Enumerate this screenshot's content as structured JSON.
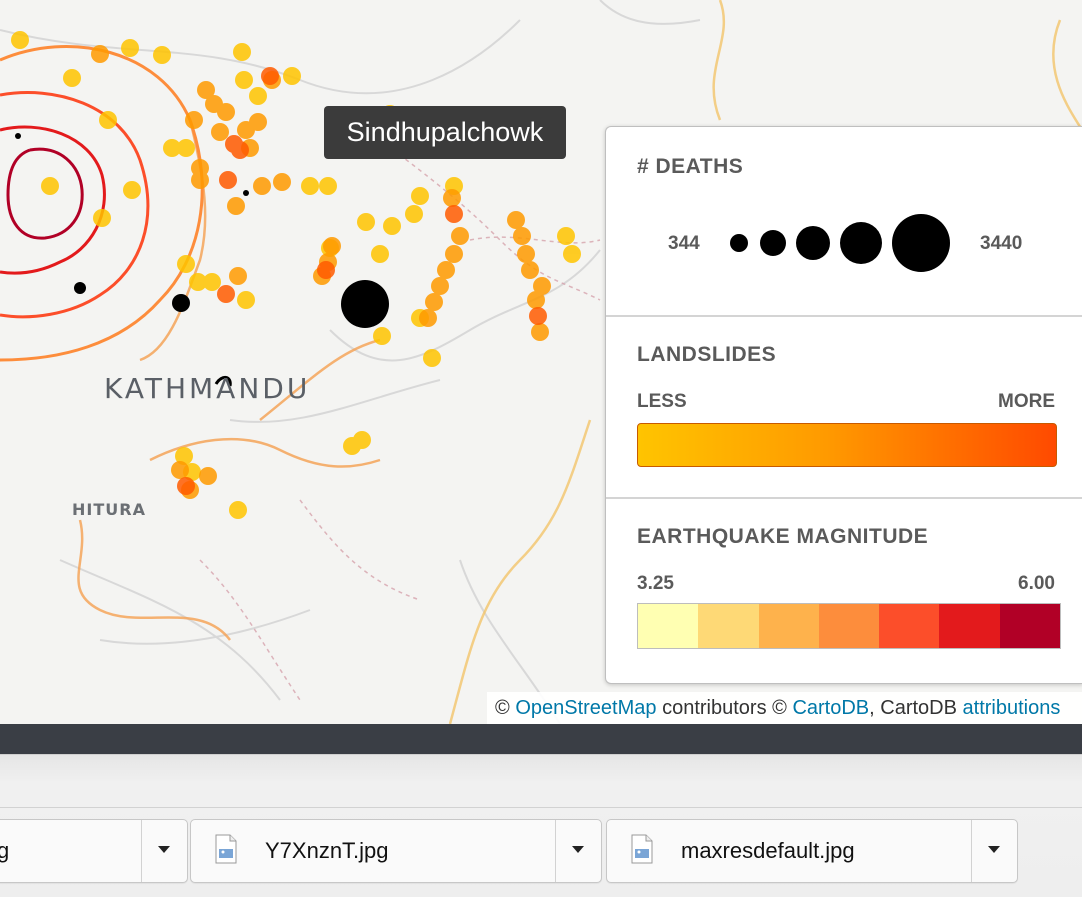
{
  "map": {
    "tooltip": "Sindhupalchowk",
    "places": {
      "city": "KATHMANDU",
      "town": "HITURA"
    }
  },
  "legend": {
    "deaths": {
      "title": "# DEATHS",
      "min": "344",
      "max": "3440"
    },
    "landslides": {
      "title": "LANDSLIDES",
      "less": "LESS",
      "more": "MORE"
    },
    "magnitude": {
      "title": "EARTHQUAKE MAGNITUDE",
      "min": "3.25",
      "max": "6.00",
      "colors": [
        "#ffffb2",
        "#fed976",
        "#feb24c",
        "#fd8d3c",
        "#fc4e2a",
        "#e31a1c",
        "#b10026"
      ]
    }
  },
  "attribution": {
    "c1": "©",
    "osm": "OpenStreetMap",
    "contrib": "contributors ©",
    "cartodb": "CartoDB",
    "comma": ", CartoDB",
    "attr": "attributions"
  },
  "downloads": [
    {
      "name": "g"
    },
    {
      "name": "Y7XnznT.jpg"
    },
    {
      "name": "maxresdefault.jpg"
    }
  ]
}
